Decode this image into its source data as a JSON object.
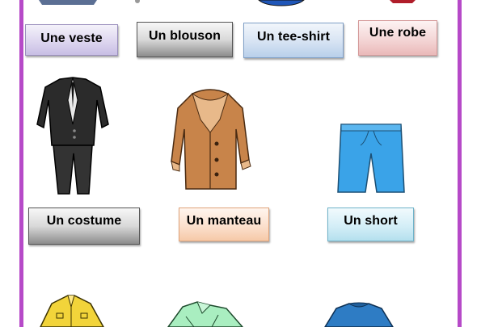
{
  "labels": {
    "veste": "Une veste",
    "blouson": "Un blouson",
    "tee_shirt": "Un tee-shirt",
    "robe": "Une robe",
    "costume": "Un costume",
    "manteau": "Un manteau",
    "short": "Un short"
  },
  "colors": {
    "border": "#b64ac8",
    "costume": "#2b2b2b",
    "manteau": "#c8844a",
    "short": "#3aa3e8",
    "bottom_left": "#f2d43a",
    "bottom_mid": "#a9eec0",
    "bottom_right": "#2e7cc4"
  }
}
